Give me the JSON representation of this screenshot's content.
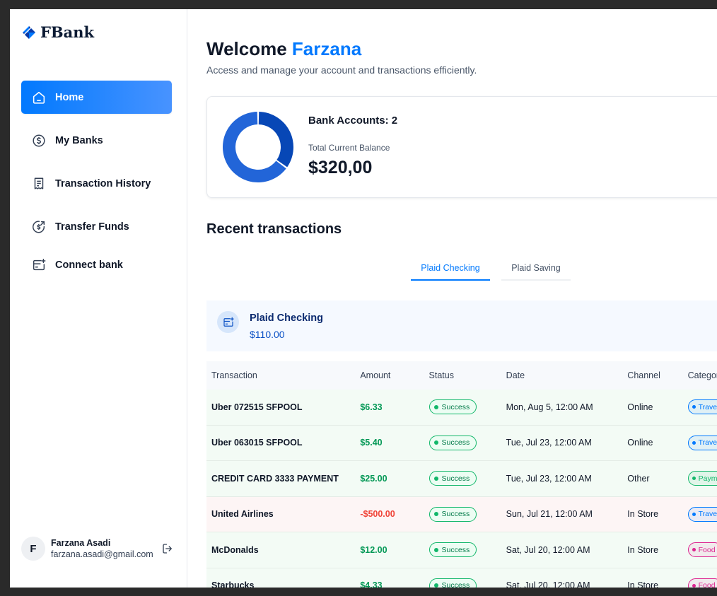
{
  "app": {
    "logo_text": "FBank"
  },
  "sidebar": {
    "items": [
      {
        "label": "Home",
        "icon": "home-icon",
        "active": true
      },
      {
        "label": "My Banks",
        "icon": "dollar-circle-icon",
        "active": false
      },
      {
        "label": "Transaction History",
        "icon": "receipt-icon",
        "active": false
      },
      {
        "label": "Transfer Funds",
        "icon": "transfer-icon",
        "active": false
      },
      {
        "label": "Connect bank",
        "icon": "connect-bank-icon",
        "active": false
      }
    ],
    "profile": {
      "initial": "F",
      "name": "Farzana Asadi",
      "email": "farzana.asadi@gmail.com"
    }
  },
  "header": {
    "welcome": "Welcome",
    "user_first_name": "Farzana",
    "subtitle": "Access and manage your account and transactions efficiently."
  },
  "summary": {
    "accounts_label": "Bank Accounts: 2",
    "balance_label": "Total Current Balance",
    "balance_value": "$320,00",
    "donut_shares": [
      0.35,
      0.65
    ],
    "donut_colors": [
      "#0747b6",
      "#2265d8"
    ]
  },
  "recent": {
    "title": "Recent transactions",
    "tabs": [
      {
        "label": "Plaid Checking",
        "active": true
      },
      {
        "label": "Plaid Saving",
        "active": false
      }
    ],
    "bank": {
      "name": "Plaid Checking",
      "amount": "$110.00"
    },
    "columns": [
      "Transaction",
      "Amount",
      "Status",
      "Date",
      "Channel",
      "Category"
    ],
    "rows": [
      {
        "name": "Uber 072515 SFPOOL",
        "amount": "$6.33",
        "status": "Success",
        "date": "Mon, Aug 5, 12:00 AM",
        "channel": "Online",
        "category": "Travel",
        "type": "pos",
        "cat_color": "#0179fe"
      },
      {
        "name": "Uber 063015 SFPOOL",
        "amount": "$5.40",
        "status": "Success",
        "date": "Tue, Jul 23, 12:00 AM",
        "channel": "Online",
        "category": "Travel",
        "type": "pos",
        "cat_color": "#0179fe"
      },
      {
        "name": "CREDIT CARD 3333 PAYMENT",
        "amount": "$25.00",
        "status": "Success",
        "date": "Tue, Jul 23, 12:00 AM",
        "channel": "Other",
        "category": "Payment",
        "type": "pos",
        "cat_color": "#12b76a"
      },
      {
        "name": "United Airlines",
        "amount": "-$500.00",
        "status": "Success",
        "date": "Sun, Jul 21, 12:00 AM",
        "channel": "In Store",
        "category": "Travel",
        "type": "neg",
        "cat_color": "#0179fe"
      },
      {
        "name": "McDonalds",
        "amount": "$12.00",
        "status": "Success",
        "date": "Sat, Jul 20, 12:00 AM",
        "channel": "In Store",
        "category": "Food",
        "type": "pos",
        "cat_color": "#dd2590"
      },
      {
        "name": "Starbucks",
        "amount": "$4.33",
        "status": "Success",
        "date": "Sat, Jul 20, 12:00 AM",
        "channel": "In Store",
        "category": "Food",
        "type": "pos",
        "cat_color": "#dd2590"
      }
    ]
  },
  "colors": {
    "accent": "#0179fe",
    "positive": "#039855",
    "negative": "#f04438"
  }
}
